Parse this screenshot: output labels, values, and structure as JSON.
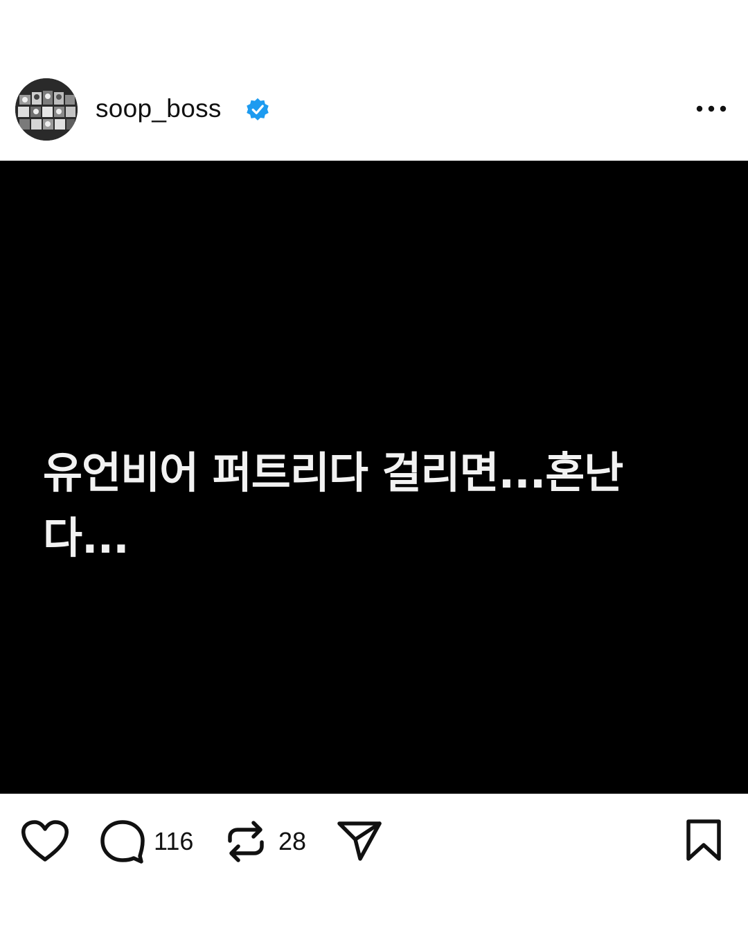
{
  "post": {
    "username": "soop_boss",
    "verified": true,
    "media_text": "유언비어 퍼트리다 걸리면...혼난다..."
  },
  "actions": {
    "like_icon": "heart-icon",
    "comment_icon": "comment-icon",
    "comment_count": "116",
    "repost_icon": "repost-icon",
    "repost_count": "28",
    "share_icon": "send-icon",
    "save_icon": "bookmark-icon"
  },
  "colors": {
    "verified": "#1D9BF0",
    "media_bg": "#000000",
    "text": "#111111"
  }
}
